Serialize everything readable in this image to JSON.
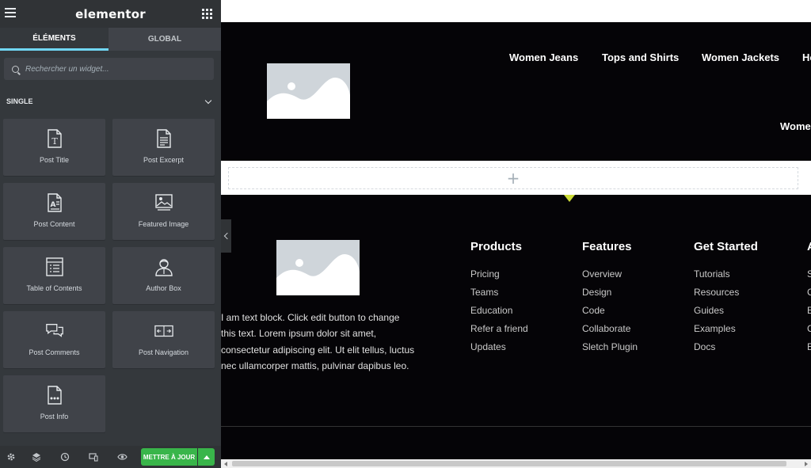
{
  "sidebar": {
    "logo": "elementor",
    "tabs": [
      "ÉLÉMENTS",
      "GLOBAL"
    ],
    "search_placeholder": "Rechercher un widget...",
    "section_title": "SINGLE",
    "widgets": [
      {
        "label": "Post Title",
        "icon": "post-title-icon"
      },
      {
        "label": "Post Excerpt",
        "icon": "post-excerpt-icon"
      },
      {
        "label": "Post Content",
        "icon": "post-content-icon"
      },
      {
        "label": "Featured Image",
        "icon": "featured-image-icon"
      },
      {
        "label": "Table of Contents",
        "icon": "table-of-contents-icon"
      },
      {
        "label": "Author Box",
        "icon": "author-box-icon"
      },
      {
        "label": "Post Comments",
        "icon": "post-comments-icon"
      },
      {
        "label": "Post Navigation",
        "icon": "post-navigation-icon"
      },
      {
        "label": "Post Info",
        "icon": "post-info-icon"
      }
    ],
    "footer": {
      "update_label": "METTRE À JOUR",
      "icons": [
        "settings-icon",
        "layers-icon",
        "history-icon",
        "responsive-icon",
        "preview-eye-icon"
      ]
    }
  },
  "preview": {
    "nav": [
      "Women Jeans",
      "Tops and Shirts",
      "Women Jackets",
      "Ho",
      "Wome"
    ],
    "footer_text": "I am text block. Click edit button to change this text. Lorem ipsum dolor sit amet, consectetur adipiscing elit. Ut elit tellus, luctus nec ullamcorper mattis, pulvinar dapibus leo.",
    "columns": [
      {
        "title": "Products",
        "links": [
          "Pricing",
          "Teams",
          "Education",
          "Refer a friend",
          "Updates"
        ]
      },
      {
        "title": "Features",
        "links": [
          "Overview",
          "Design",
          "Code",
          "Collaborate",
          "Sletch Plugin"
        ]
      },
      {
        "title": "Get Started",
        "links": [
          "Tutorials",
          "Resources",
          "Guides",
          "Examples",
          "Docs"
        ]
      },
      {
        "title": "A",
        "links": [
          "S",
          "C",
          "E",
          "C",
          "E"
        ]
      }
    ],
    "add_section_symbol": "+"
  },
  "colors": {
    "accent_tab": "#71d7f7",
    "update_green": "#39b54a",
    "panel_bg": "#34383c",
    "preview_dark": "#050407",
    "section_marker": "#cddc39"
  }
}
